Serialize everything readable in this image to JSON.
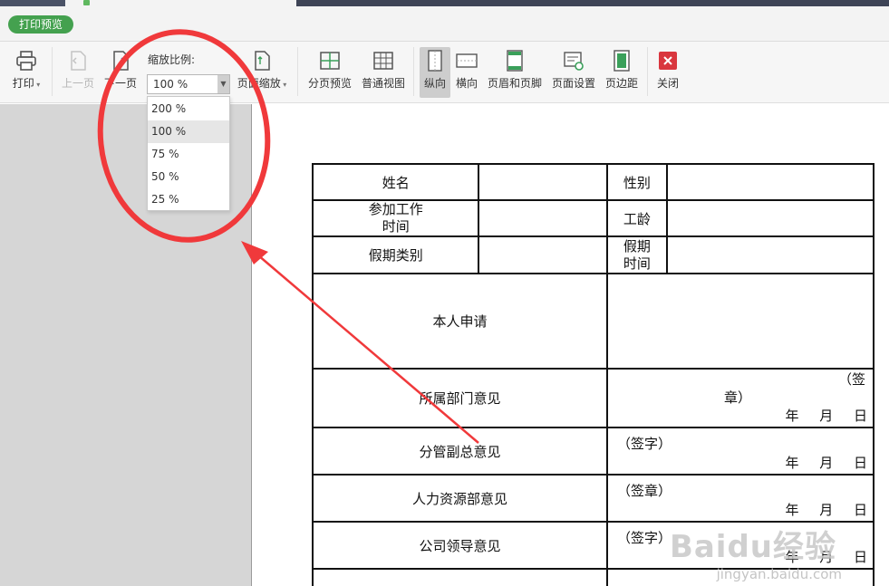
{
  "app": {
    "print_preview_label": "打印预览"
  },
  "ribbon": {
    "print": "打印",
    "prev_page": "上一页",
    "next_page": "下一页",
    "zoom_label": "缩放比例:",
    "zoom_value": "100 %",
    "page_zoom": "页面缩放",
    "page_preview": "分页预览",
    "normal_view": "普通视图",
    "portrait": "纵向",
    "landscape": "横向",
    "header_footer": "页眉和页脚",
    "page_setup": "页面设置",
    "margins": "页边距",
    "close": "关闭"
  },
  "zoom_options": [
    "200 %",
    "100 %",
    "75 %",
    "50 %",
    "25 %"
  ],
  "form": {
    "name": "姓名",
    "gender": "性别",
    "work_start_1": "参加工作",
    "work_start_2": "时间",
    "seniority": "工龄",
    "leave_type": "假期类别",
    "leave_time_1": "假期",
    "leave_time_2": "时间",
    "self_apply": "本人申请",
    "dept_opinion": "所属部门意见",
    "dept_sig_1": "（签",
    "dept_sig_2": "章）",
    "date": "年 月 日",
    "vp_opinion": "分管副总意见",
    "vp_tag": "（签字）",
    "hr_opinion": "人力资源部意见",
    "hr_tag": "（签章）",
    "leader_opinion": "公司领导意见",
    "leader_tag": "（签字）"
  },
  "watermark": {
    "logo": "Baidu经验",
    "url": "jingyan.baidu.com"
  },
  "colors": {
    "badge_green": "#44a14f",
    "annotation_red": "#f0393b",
    "close_red": "#d9363e"
  }
}
